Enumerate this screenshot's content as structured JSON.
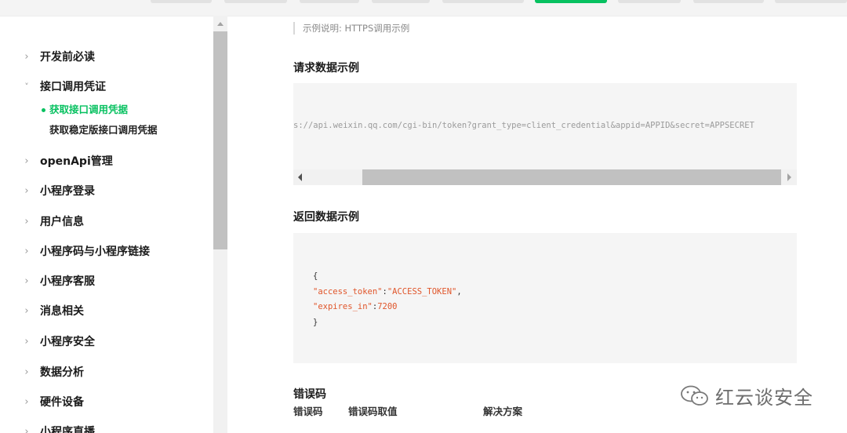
{
  "sidebar": {
    "items": [
      {
        "label": "开发前必读",
        "chevron": "›"
      },
      {
        "label": "接口调用凭证",
        "chevron": "˅"
      },
      {
        "label": "openApi管理",
        "chevron": "›"
      },
      {
        "label": "小程序登录",
        "chevron": "›"
      },
      {
        "label": "用户信息",
        "chevron": "›"
      },
      {
        "label": "小程序码与小程序链接",
        "chevron": "›"
      },
      {
        "label": "小程序客服",
        "chevron": "›"
      },
      {
        "label": "消息相关",
        "chevron": "›"
      },
      {
        "label": "小程序安全",
        "chevron": "›"
      },
      {
        "label": "数据分析",
        "chevron": "›"
      },
      {
        "label": "硬件设备",
        "chevron": "›"
      },
      {
        "label": "小程序直播",
        "chevron": "›"
      }
    ],
    "subitems": [
      {
        "label": "获取接口调用凭据",
        "active": true
      },
      {
        "label": "获取稳定版接口调用凭据",
        "active": false
      }
    ]
  },
  "main": {
    "note": "示例说明: HTTPS调用示例",
    "request": {
      "heading": "请求数据示例",
      "code": "s://api.weixin.qq.com/cgi-bin/token?grant_type=client_credential&appid=APPID&secret=APPSECRET"
    },
    "response": {
      "heading": "返回数据示例",
      "open": "{",
      "k1": "\"access_token\"",
      "v1": "\"ACCESS_TOKEN\"",
      "k2": "\"expires_in\"",
      "v2": "7200",
      "close": "}"
    },
    "errors": {
      "heading": "错误码",
      "columns": [
        "错误码",
        "错误码取值",
        "解决方案"
      ]
    }
  },
  "watermark": {
    "text": "红云谈安全",
    "icon": "wechat-icon"
  },
  "colors": {
    "accent": "#07c160",
    "json_key": "#e0562b"
  }
}
